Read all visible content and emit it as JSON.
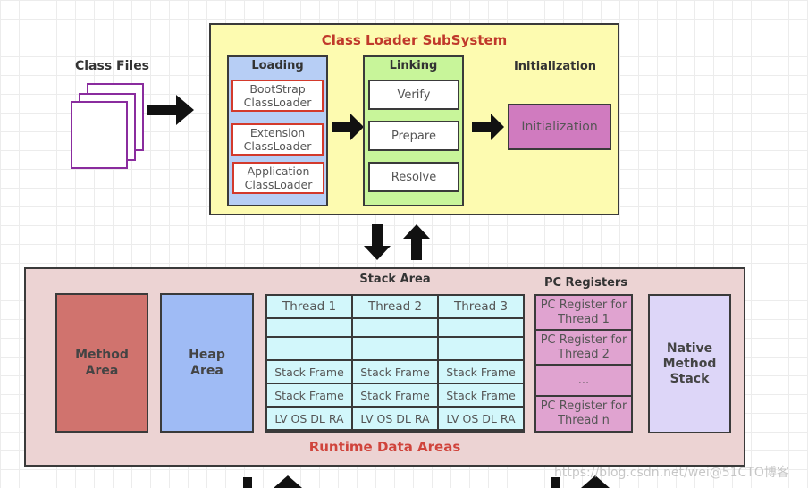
{
  "class_files": {
    "label": "Class Files"
  },
  "class_loader_subsystem": {
    "title": "Class Loader SubSystem",
    "loading": {
      "title": "Loading",
      "loaders": [
        {
          "line1": "BootStrap",
          "line2": "ClassLoader"
        },
        {
          "line1": "Extension",
          "line2": "ClassLoader"
        },
        {
          "line1": "Application",
          "line2": "ClassLoader"
        }
      ]
    },
    "linking": {
      "title": "Linking",
      "steps": [
        "Verify",
        "Prepare",
        "Resolve"
      ]
    },
    "initialization": {
      "title": "Initialization",
      "box_label": "Initialization"
    }
  },
  "runtime_data_areas": {
    "title": "Runtime Data Areas",
    "method_area": {
      "line1": "Method",
      "line2": "Area"
    },
    "heap_area": {
      "line1": "Heap",
      "line2": "Area"
    },
    "stack_area": {
      "title": "Stack Area",
      "threads": [
        "Thread 1",
        "Thread 2",
        "Thread 3"
      ],
      "frame_label": "Stack Frame",
      "frame_detail": "LV OS DL RA"
    },
    "pc_registers": {
      "title": "PC Registers",
      "cells": [
        {
          "line1": "PC Register for",
          "line2": "Thread 1"
        },
        {
          "line1": "PC Register for",
          "line2": "Thread 2"
        },
        {
          "line1": "...",
          "line2": ""
        },
        {
          "line1": "PC Register for",
          "line2": "Thread n"
        }
      ]
    },
    "native_method_stack": {
      "line1": "Native",
      "line2": "Method",
      "line3": "Stack"
    }
  },
  "watermark": "https://blog.csdn.net/wei@51CTO博客",
  "colors": {
    "subsystem_bg": "#fdfbb0",
    "subsystem_title": "#c0392b",
    "loading_bg": "#b7cef5",
    "loader_border": "#d33a2c",
    "linking_bg": "#c8f59a",
    "initialization_bg": "#d07bbf",
    "runtime_bg": "#ecd3d3",
    "runtime_title": "#d0443c",
    "method_area_bg": "#d0736e",
    "heap_area_bg": "#9fbbf5",
    "stack_cell_bg": "#d2f7fb",
    "pc_register_bg": "#e0a3d0",
    "native_stack_bg": "#ddd6f8",
    "class_file_border": "#8a2c9e"
  }
}
